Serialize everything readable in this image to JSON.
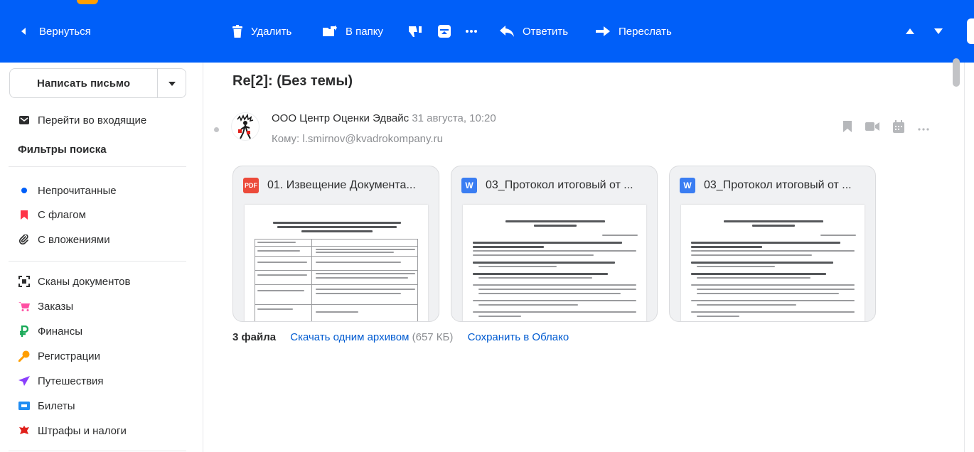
{
  "toolbar": {
    "back_label": "Вернуться",
    "delete_label": "Удалить",
    "to_folder_label": "В папку",
    "reply_label": "Ответить",
    "forward_label": "Переслать"
  },
  "sidebar": {
    "compose_label": "Написать письмо",
    "inbox_label": "Перейти во входящие",
    "filters_heading": "Фильтры поиска",
    "filters": [
      {
        "label": "Непрочитанные",
        "icon": "unread-dot-icon",
        "color": "#005ff9"
      },
      {
        "label": "С флагом",
        "icon": "flag-icon",
        "color": "#ff3347"
      },
      {
        "label": "С вложениями",
        "icon": "paperclip-icon",
        "color": "#2c2d2e"
      }
    ],
    "categories": [
      {
        "label": "Сканы документов",
        "icon": "scan-icon",
        "color": "#2c2d2e"
      },
      {
        "label": "Заказы",
        "icon": "cart-icon",
        "color": "#ff4fa3"
      },
      {
        "label": "Финансы",
        "icon": "ruble-icon",
        "color": "#18a957"
      },
      {
        "label": "Регистрации",
        "icon": "key-icon",
        "color": "#ff9e00"
      },
      {
        "label": "Путешествия",
        "icon": "plane-icon",
        "color": "#8b3ffc"
      },
      {
        "label": "Билеты",
        "icon": "ticket-icon",
        "color": "#1f8cf2"
      },
      {
        "label": "Штрафы и налоги",
        "icon": "emblem-icon",
        "color": "#e0201b"
      }
    ]
  },
  "message": {
    "subject": "Re[2]: (Без темы)",
    "sender": "ООО Центр Оценки Эдвайс",
    "date": "31 августа, 10:20",
    "to": "Кому: l.smirnov@kvadrokompany.ru"
  },
  "attachments": [
    {
      "type": "PDF",
      "name": "01. Извещение Документа..."
    },
    {
      "type": "W",
      "name": "03_Протокол итоговый от ..."
    },
    {
      "type": "W",
      "name": "03_Протокол итоговый от ..."
    }
  ],
  "attachments_footer": {
    "count": "3 файла",
    "download_label": "Скачать одним архивом",
    "size": "(657 КБ)",
    "cloud_label": "Сохранить в Облако"
  },
  "colors": {
    "toolbar_bg": "#005ff9",
    "link": "#005bd1"
  }
}
